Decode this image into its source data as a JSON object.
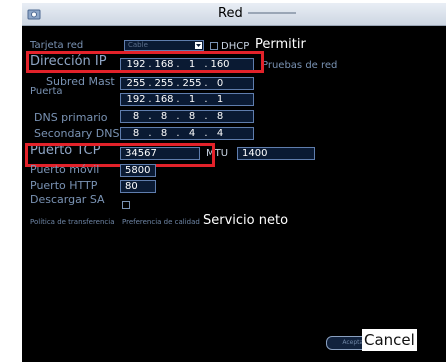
{
  "window": {
    "title": "Red"
  },
  "form": {
    "tarjeta_red": {
      "label": "Tarjeta red",
      "value": "Cable"
    },
    "dhcp": {
      "label": "DHCP",
      "checked": false,
      "overlay_label": "Permitir"
    },
    "ip": {
      "label": "Dirección IP",
      "octets": [
        "192",
        "168",
        "1",
        "160"
      ]
    },
    "pruebas_red": "Pruebas de red",
    "subred": {
      "label": "Subred Mast",
      "octets": [
        "255",
        "255",
        "255",
        "0"
      ]
    },
    "puerta": {
      "label": "Puerta",
      "octets": [
        "192",
        "168",
        "1",
        "1"
      ]
    },
    "dns_primario": {
      "label": "DNS primario",
      "octets": [
        "8",
        "8",
        "8",
        "8"
      ]
    },
    "dns_secundario": {
      "label": "Secondary DNS",
      "octets": [
        "8",
        "8",
        "4",
        "4"
      ]
    },
    "puerto_tcp": {
      "label": "Puerto TCP",
      "value": "34567"
    },
    "mtu": {
      "label": "MTU",
      "value": "1400"
    },
    "puerto_movil": {
      "label": "Puerto móvil",
      "value": "5800"
    },
    "puerto_http": {
      "label": "Puerto HTTP",
      "value": "80"
    },
    "descargar_sa": {
      "label": "Descargar SA",
      "checked": false
    },
    "politica": {
      "label": "Política de transferencia",
      "value": "Preferencia de calidad",
      "overlay_label": "Servicio neto"
    }
  },
  "buttons": {
    "ok": "Aceptar",
    "cancel": "Cancel"
  },
  "colors": {
    "background": "#000000",
    "label": "#7a93b4",
    "field_border": "#5f7dad",
    "highlight": "#e3222a",
    "titlebar": "#dde4ee"
  },
  "icons": {
    "window": "network-settings-icon"
  }
}
